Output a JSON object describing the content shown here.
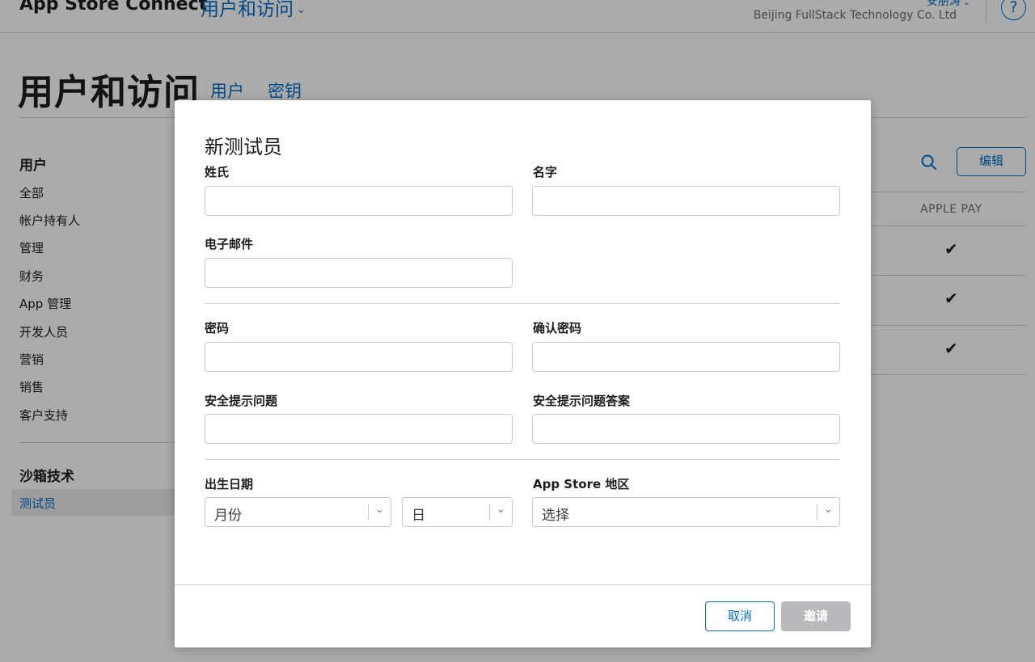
{
  "header": {
    "brand": "App Store Connect",
    "section": "用户和访问",
    "user_name": "安朋涛",
    "organization": "Beijing FullStack Technology Co. Ltd",
    "help": "?"
  },
  "page": {
    "title": "用户和访问",
    "tabs": [
      {
        "label": "用户"
      },
      {
        "label": "密钥"
      }
    ]
  },
  "sidebar": {
    "users_heading": "用户",
    "user_items": [
      {
        "label": "全部"
      },
      {
        "label": "帐户持有人"
      },
      {
        "label": "管理"
      },
      {
        "label": "财务"
      },
      {
        "label": "App 管理"
      },
      {
        "label": "开发人员"
      },
      {
        "label": "营销"
      },
      {
        "label": "销售"
      },
      {
        "label": "客户支持"
      }
    ],
    "sandbox_heading": "沙箱技术",
    "sandbox_items": [
      {
        "label": "测试员"
      }
    ]
  },
  "table": {
    "edit_label": "编辑",
    "column_header": "APPLE PAY",
    "rows": [
      {
        "apple_pay": "✔"
      },
      {
        "apple_pay": "✔"
      },
      {
        "apple_pay": "✔"
      }
    ]
  },
  "dialog": {
    "title": "新测试员",
    "fields": {
      "last_name": {
        "label": "姓氏",
        "value": ""
      },
      "first_name": {
        "label": "名字",
        "value": ""
      },
      "email": {
        "label": "电子邮件",
        "value": ""
      },
      "password": {
        "label": "密码",
        "value": ""
      },
      "confirm_password": {
        "label": "确认密码",
        "value": ""
      },
      "security_question": {
        "label": "安全提示问题",
        "value": ""
      },
      "security_answer": {
        "label": "安全提示问题答案",
        "value": ""
      }
    },
    "birth_date": {
      "label": "出生日期",
      "month_value": "月份",
      "day_value": "日"
    },
    "region": {
      "label": "App Store 地区",
      "value": "选择"
    },
    "cancel_label": "取消",
    "invite_label": "邀请"
  },
  "icons": {
    "chevron": "chevron-down-icon",
    "search": "search-icon",
    "check": "checkmark-icon"
  },
  "colors": {
    "accent": "#0070c9",
    "disabled_button": "#b9b9bd",
    "overlay": "rgba(0,0,0,0.33)"
  }
}
